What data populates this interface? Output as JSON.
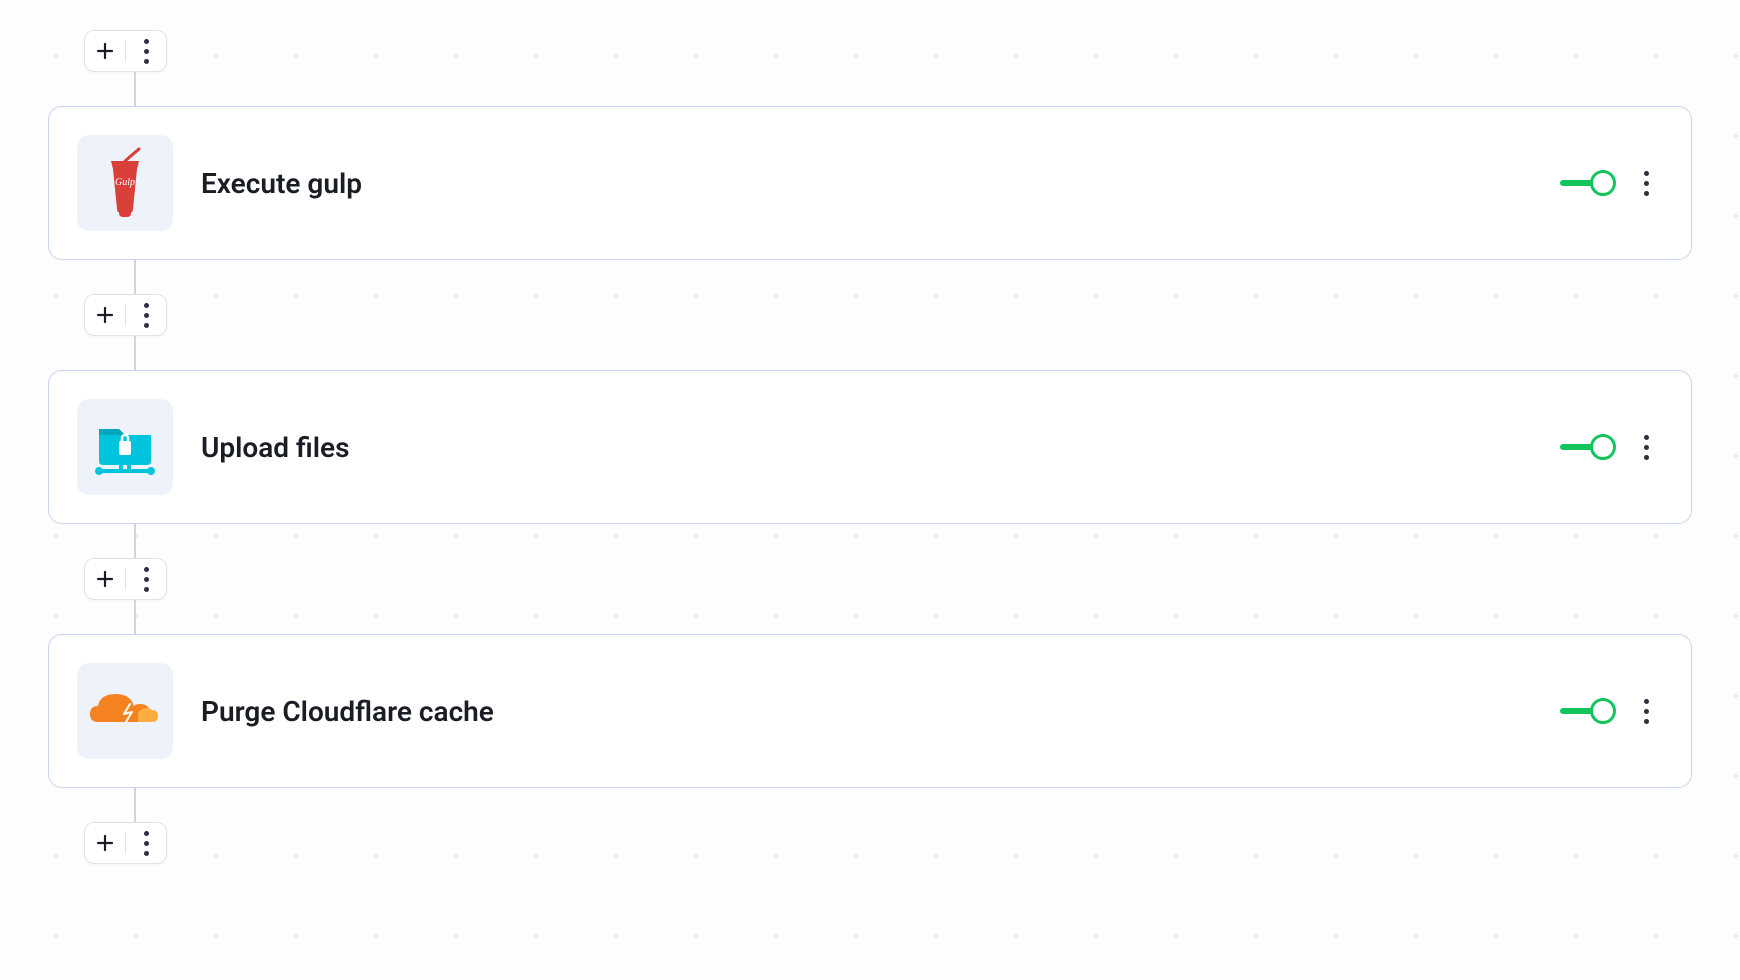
{
  "pipeline": {
    "steps": [
      {
        "title": "Execute gulp",
        "icon": "gulp",
        "enabled": true
      },
      {
        "title": "Upload files",
        "icon": "ftp-upload",
        "enabled": true
      },
      {
        "title": "Purge Cloudflare cache",
        "icon": "cloudflare",
        "enabled": true
      }
    ]
  },
  "colors": {
    "card_border": "#c9d4f2",
    "toggle_on": "#14c35a",
    "icon_bg": "#eef2fb",
    "gulp": "#d9403a",
    "ftp": "#00b7d4",
    "cloudflare": "#f58220"
  }
}
